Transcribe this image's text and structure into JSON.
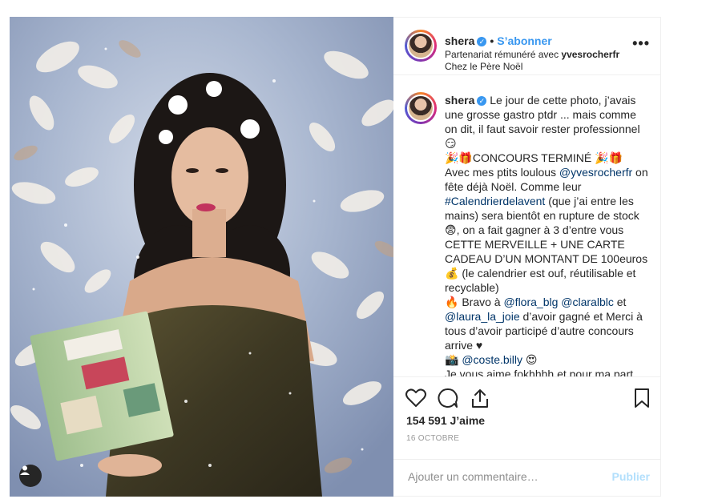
{
  "post": {
    "username": "shera",
    "follow_label": "S’abonner",
    "separator": "•",
    "partnership_prefix": "Partenariat rémunéré avec ",
    "partner": "yvesrocherfr",
    "location": "Chez le Père Noël",
    "more_label": "•••"
  },
  "caption": {
    "username": "shera",
    "segments": [
      {
        "t": "Le jour de cette photo, j’avais une grosse gastro ptdr ... mais comme on dit, il faut savoir rester professionnel 😏"
      },
      {
        "t": "🎉🎁CONCOURS TERMINÉ 🎉🎁"
      },
      {
        "t": "Avec mes ptits loulous "
      },
      {
        "t": "@yvesrocherfr",
        "link": true
      },
      {
        "t": " on fête déjà Noël. Comme leur "
      },
      {
        "t": "#Calendrierdelavent",
        "link": true
      },
      {
        "t": " (que j’ai entre les mains) sera bientôt en rupture de stock 😨, on a fait gagner à 3 d’entre vous CETTE MERVEILLE + UNE CARTE CADEAU D’UN MONTANT DE 100euros 💰 (le calendrier est ouf, réutilisable et recyclable)"
      },
      {
        "t": "🔥 Bravo à "
      },
      {
        "t": "@flora_blg",
        "link": true
      },
      {
        "t": " "
      },
      {
        "t": "@claralblc",
        "link": true
      },
      {
        "t": " et "
      },
      {
        "t": "@laura_la_joie",
        "link": true
      },
      {
        "t": " d’avoir gagné et Merci à tous d’avoir participé d’autre concours arrive ♥"
      },
      {
        "t": "📸 "
      },
      {
        "t": "@coste.billy",
        "link": true
      },
      {
        "t": " 😍"
      },
      {
        "t": "Je vous aime fokhhhh et pour ma part"
      }
    ]
  },
  "stats": {
    "likes": "154 591 J’aime",
    "date": "16 OCTOBRE"
  },
  "comment": {
    "placeholder": "Ajouter un commentaire…",
    "publish_label": "Publier"
  },
  "icons": {
    "like": "heart-icon",
    "comment": "comment-bubble-icon",
    "share": "share-icon",
    "save": "bookmark-icon",
    "more": "more-options-icon",
    "verified": "verified-badge-icon",
    "user_tag": "user-tag-icon"
  },
  "colors": {
    "link": "#003569",
    "follow": "#3897f0",
    "publish_disabled": "#b2dffc",
    "verified": "#3897f0",
    "date": "#999999"
  }
}
